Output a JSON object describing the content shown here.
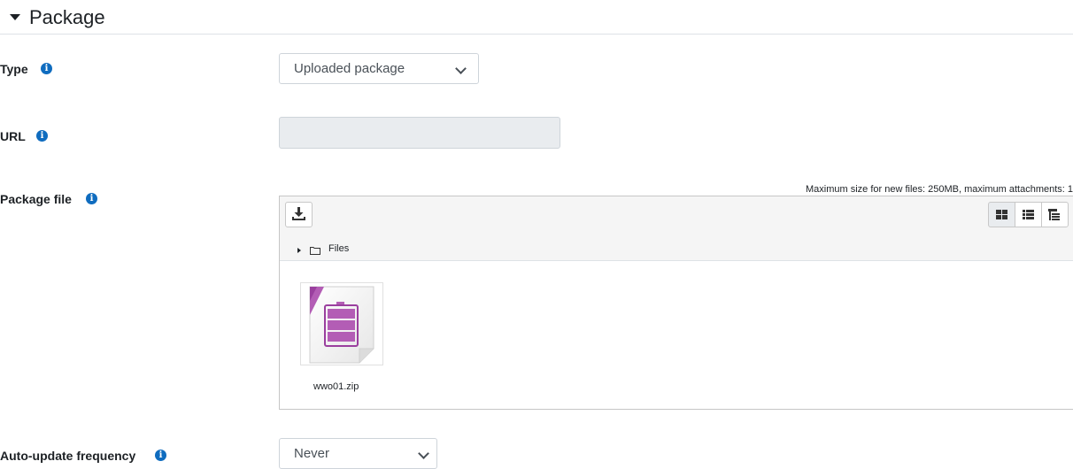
{
  "section": {
    "title": "Package"
  },
  "type_field": {
    "label": "Type",
    "value": "Uploaded package"
  },
  "url_field": {
    "label": "URL",
    "value": ""
  },
  "package_file": {
    "label": "Package file",
    "max_size_text": "Maximum size for new files: 250MB, maximum attachments: 1",
    "path_label": "Files",
    "files": [
      {
        "name": "wwo01.zip"
      }
    ]
  },
  "auto_update": {
    "label": "Auto-update frequency",
    "value": "Never"
  },
  "icons": {
    "section_toggle": "caret-down-icon",
    "info": "info-icon",
    "download": "download-icon",
    "grid_view": "grid-view-icon",
    "list_view": "list-view-icon",
    "tree_view": "tree-view-icon",
    "folder": "folder-icon",
    "archive": "archive-file-icon"
  },
  "colors": {
    "info_blue": "#0f6cbf",
    "readonly_bg": "#e9ecef",
    "archive_purple": "#b35db5"
  }
}
